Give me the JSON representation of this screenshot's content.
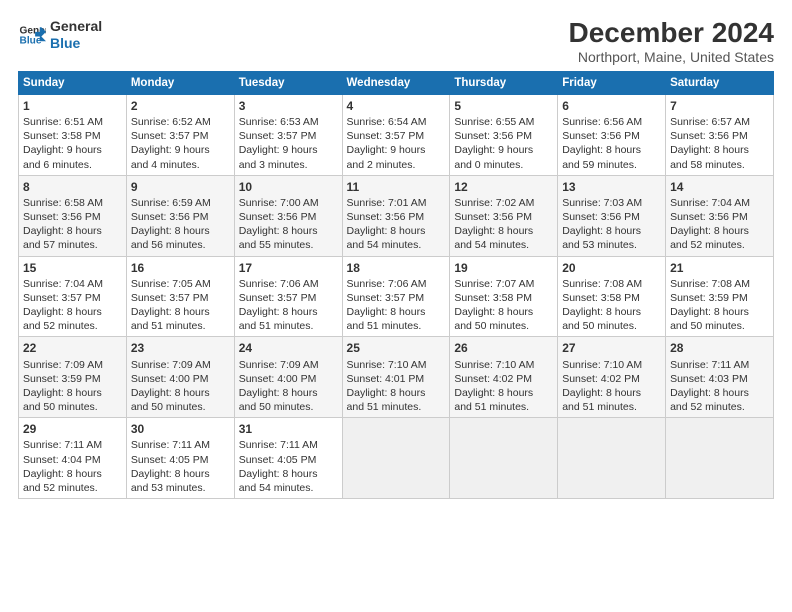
{
  "logo": {
    "line1": "General",
    "line2": "Blue"
  },
  "title": "December 2024",
  "subtitle": "Northport, Maine, United States",
  "days_header": [
    "Sunday",
    "Monday",
    "Tuesday",
    "Wednesday",
    "Thursday",
    "Friday",
    "Saturday"
  ],
  "weeks": [
    [
      {
        "day": "1",
        "lines": [
          "Sunrise: 6:51 AM",
          "Sunset: 3:58 PM",
          "Daylight: 9 hours",
          "and 6 minutes."
        ]
      },
      {
        "day": "2",
        "lines": [
          "Sunrise: 6:52 AM",
          "Sunset: 3:57 PM",
          "Daylight: 9 hours",
          "and 4 minutes."
        ]
      },
      {
        "day": "3",
        "lines": [
          "Sunrise: 6:53 AM",
          "Sunset: 3:57 PM",
          "Daylight: 9 hours",
          "and 3 minutes."
        ]
      },
      {
        "day": "4",
        "lines": [
          "Sunrise: 6:54 AM",
          "Sunset: 3:57 PM",
          "Daylight: 9 hours",
          "and 2 minutes."
        ]
      },
      {
        "day": "5",
        "lines": [
          "Sunrise: 6:55 AM",
          "Sunset: 3:56 PM",
          "Daylight: 9 hours",
          "and 0 minutes."
        ]
      },
      {
        "day": "6",
        "lines": [
          "Sunrise: 6:56 AM",
          "Sunset: 3:56 PM",
          "Daylight: 8 hours",
          "and 59 minutes."
        ]
      },
      {
        "day": "7",
        "lines": [
          "Sunrise: 6:57 AM",
          "Sunset: 3:56 PM",
          "Daylight: 8 hours",
          "and 58 minutes."
        ]
      }
    ],
    [
      {
        "day": "8",
        "lines": [
          "Sunrise: 6:58 AM",
          "Sunset: 3:56 PM",
          "Daylight: 8 hours",
          "and 57 minutes."
        ]
      },
      {
        "day": "9",
        "lines": [
          "Sunrise: 6:59 AM",
          "Sunset: 3:56 PM",
          "Daylight: 8 hours",
          "and 56 minutes."
        ]
      },
      {
        "day": "10",
        "lines": [
          "Sunrise: 7:00 AM",
          "Sunset: 3:56 PM",
          "Daylight: 8 hours",
          "and 55 minutes."
        ]
      },
      {
        "day": "11",
        "lines": [
          "Sunrise: 7:01 AM",
          "Sunset: 3:56 PM",
          "Daylight: 8 hours",
          "and 54 minutes."
        ]
      },
      {
        "day": "12",
        "lines": [
          "Sunrise: 7:02 AM",
          "Sunset: 3:56 PM",
          "Daylight: 8 hours",
          "and 54 minutes."
        ]
      },
      {
        "day": "13",
        "lines": [
          "Sunrise: 7:03 AM",
          "Sunset: 3:56 PM",
          "Daylight: 8 hours",
          "and 53 minutes."
        ]
      },
      {
        "day": "14",
        "lines": [
          "Sunrise: 7:04 AM",
          "Sunset: 3:56 PM",
          "Daylight: 8 hours",
          "and 52 minutes."
        ]
      }
    ],
    [
      {
        "day": "15",
        "lines": [
          "Sunrise: 7:04 AM",
          "Sunset: 3:57 PM",
          "Daylight: 8 hours",
          "and 52 minutes."
        ]
      },
      {
        "day": "16",
        "lines": [
          "Sunrise: 7:05 AM",
          "Sunset: 3:57 PM",
          "Daylight: 8 hours",
          "and 51 minutes."
        ]
      },
      {
        "day": "17",
        "lines": [
          "Sunrise: 7:06 AM",
          "Sunset: 3:57 PM",
          "Daylight: 8 hours",
          "and 51 minutes."
        ]
      },
      {
        "day": "18",
        "lines": [
          "Sunrise: 7:06 AM",
          "Sunset: 3:57 PM",
          "Daylight: 8 hours",
          "and 51 minutes."
        ]
      },
      {
        "day": "19",
        "lines": [
          "Sunrise: 7:07 AM",
          "Sunset: 3:58 PM",
          "Daylight: 8 hours",
          "and 50 minutes."
        ]
      },
      {
        "day": "20",
        "lines": [
          "Sunrise: 7:08 AM",
          "Sunset: 3:58 PM",
          "Daylight: 8 hours",
          "and 50 minutes."
        ]
      },
      {
        "day": "21",
        "lines": [
          "Sunrise: 7:08 AM",
          "Sunset: 3:59 PM",
          "Daylight: 8 hours",
          "and 50 minutes."
        ]
      }
    ],
    [
      {
        "day": "22",
        "lines": [
          "Sunrise: 7:09 AM",
          "Sunset: 3:59 PM",
          "Daylight: 8 hours",
          "and 50 minutes."
        ]
      },
      {
        "day": "23",
        "lines": [
          "Sunrise: 7:09 AM",
          "Sunset: 4:00 PM",
          "Daylight: 8 hours",
          "and 50 minutes."
        ]
      },
      {
        "day": "24",
        "lines": [
          "Sunrise: 7:09 AM",
          "Sunset: 4:00 PM",
          "Daylight: 8 hours",
          "and 50 minutes."
        ]
      },
      {
        "day": "25",
        "lines": [
          "Sunrise: 7:10 AM",
          "Sunset: 4:01 PM",
          "Daylight: 8 hours",
          "and 51 minutes."
        ]
      },
      {
        "day": "26",
        "lines": [
          "Sunrise: 7:10 AM",
          "Sunset: 4:02 PM",
          "Daylight: 8 hours",
          "and 51 minutes."
        ]
      },
      {
        "day": "27",
        "lines": [
          "Sunrise: 7:10 AM",
          "Sunset: 4:02 PM",
          "Daylight: 8 hours",
          "and 51 minutes."
        ]
      },
      {
        "day": "28",
        "lines": [
          "Sunrise: 7:11 AM",
          "Sunset: 4:03 PM",
          "Daylight: 8 hours",
          "and 52 minutes."
        ]
      }
    ],
    [
      {
        "day": "29",
        "lines": [
          "Sunrise: 7:11 AM",
          "Sunset: 4:04 PM",
          "Daylight: 8 hours",
          "and 52 minutes."
        ]
      },
      {
        "day": "30",
        "lines": [
          "Sunrise: 7:11 AM",
          "Sunset: 4:05 PM",
          "Daylight: 8 hours",
          "and 53 minutes."
        ]
      },
      {
        "day": "31",
        "lines": [
          "Sunrise: 7:11 AM",
          "Sunset: 4:05 PM",
          "Daylight: 8 hours",
          "and 54 minutes."
        ]
      },
      null,
      null,
      null,
      null
    ]
  ]
}
